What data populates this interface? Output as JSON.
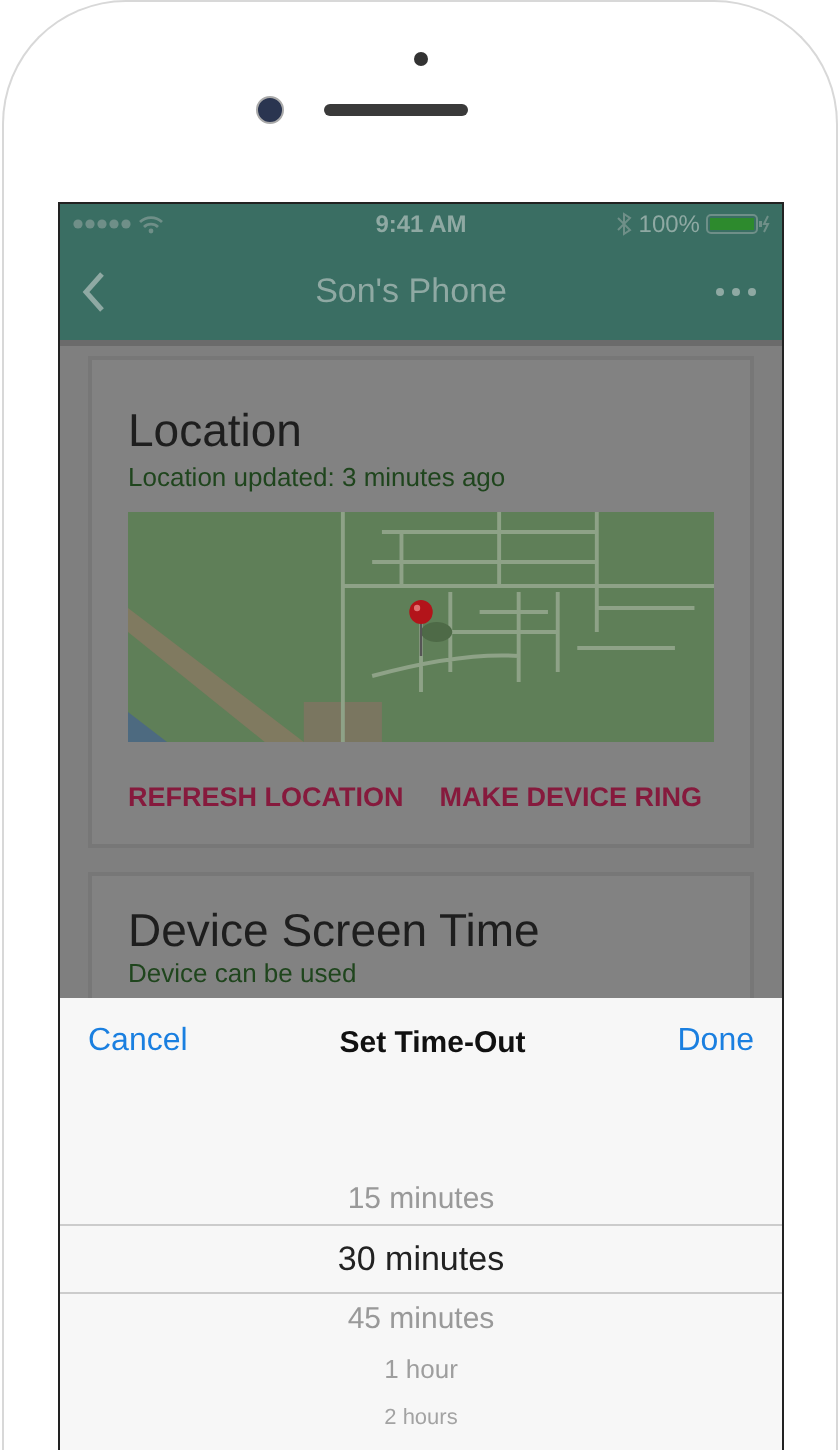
{
  "status_bar": {
    "time": "9:41 AM",
    "battery": "100%"
  },
  "nav": {
    "title": "Son's Phone"
  },
  "location_card": {
    "title": "Location",
    "subtitle": "Location updated: 3 minutes ago",
    "actions": [
      "REFRESH LOCATION",
      "MAKE DEVICE RING"
    ]
  },
  "screen_time_card": {
    "title": "Device Screen Time",
    "subtitle": "Device can be used"
  },
  "picker": {
    "cancel": "Cancel",
    "title": "Set Time-Out",
    "done": "Done",
    "options": [
      {
        "label": "15 minutes",
        "selected": false
      },
      {
        "label": "30 minutes",
        "selected": true
      },
      {
        "label": "45 minutes",
        "selected": false
      },
      {
        "label": "1 hour",
        "selected": false
      },
      {
        "label": "2 hours",
        "selected": false
      }
    ]
  }
}
